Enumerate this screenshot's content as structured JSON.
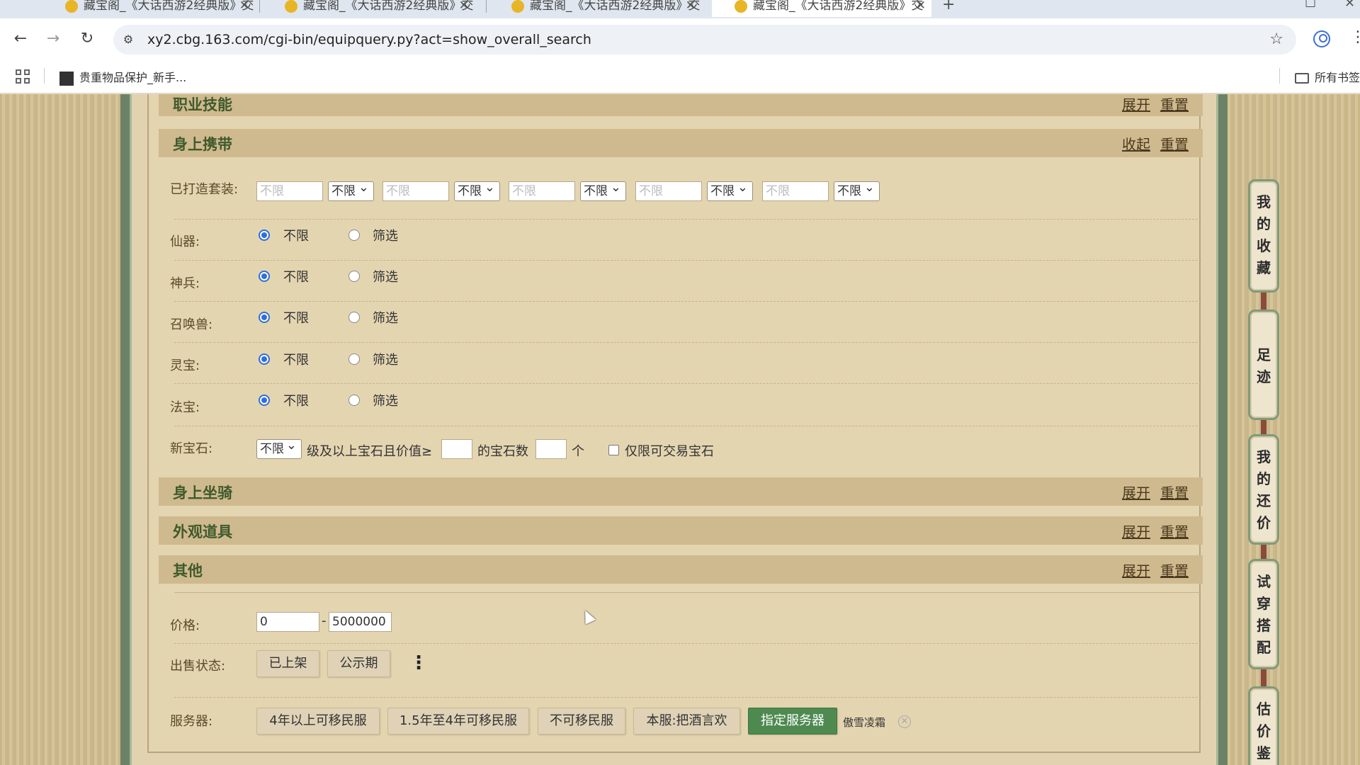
{
  "browser": {
    "tabs": [
      {
        "title": "藏宝阁_《大话西游2经典版》交"
      },
      {
        "title": "藏宝阁_《大话西游2经典版》交"
      },
      {
        "title": "藏宝阁_《大话西游2经典版》交"
      },
      {
        "title": "藏宝阁_《大话西游2经典版》交"
      }
    ],
    "new_tab": "+",
    "url": "xy2.cbg.163.com/cgi-bin/equipquery.py?act=show_overall_search",
    "bookmarks": [
      {
        "label": "贵重物品保护_新手..."
      }
    ],
    "all_bookmarks_label": "所有书签"
  },
  "sections": {
    "career_skill": {
      "title": "职业技能",
      "expand": "展开",
      "reset": "重置"
    },
    "carried": {
      "title": "身上携带",
      "collapse": "收起",
      "reset": "重置"
    },
    "mount": {
      "title": "身上坐骑",
      "expand": "展开",
      "reset": "重置"
    },
    "appearance": {
      "title": "外观道具",
      "expand": "展开",
      "reset": "重置"
    },
    "other": {
      "title": "其他",
      "expand": "展开",
      "reset": "重置"
    }
  },
  "carried": {
    "forged_set_label": "已打造套装:",
    "forged_set_inputs": [
      {
        "placeholder": "不限",
        "select": "不限"
      },
      {
        "placeholder": "不限",
        "select": "不限"
      },
      {
        "placeholder": "不限",
        "select": "不限"
      },
      {
        "placeholder": "不限",
        "select": "不限"
      },
      {
        "placeholder": "不限",
        "select": "不限"
      }
    ],
    "radio_rows": [
      {
        "label": "仙器:",
        "opt_any": "不限",
        "opt_filter": "筛选",
        "selected": "不限"
      },
      {
        "label": "神兵:",
        "opt_any": "不限",
        "opt_filter": "筛选",
        "selected": "不限"
      },
      {
        "label": "召唤兽:",
        "opt_any": "不限",
        "opt_filter": "筛选",
        "selected": "不限"
      },
      {
        "label": "灵宝:",
        "opt_any": "不限",
        "opt_filter": "筛选",
        "selected": "不限"
      },
      {
        "label": "法宝:",
        "opt_any": "不限",
        "opt_filter": "筛选",
        "selected": "不限"
      }
    ],
    "gem": {
      "label": "新宝石:",
      "level_select": "不限",
      "text_level": "级及以上宝石且价值≥",
      "value_input": "",
      "text_count": "的宝石数",
      "count_input": "",
      "text_unit": "个",
      "tradable_only_label": "仅限可交易宝石",
      "tradable_only_checked": false
    }
  },
  "other": {
    "price_label": "价格:",
    "price_min": "0",
    "price_sep": "-",
    "price_max": "5000000",
    "sale_status_label": "出售状态:",
    "sale_status_buttons": [
      "已上架",
      "公示期"
    ],
    "more_icon": "⋮",
    "server_label": "服务器:",
    "server_buttons": [
      "4年以上可移民服",
      "1.5年至4年可移民服",
      "不可移民服",
      "本服:把酒言欢",
      "指定服务器"
    ],
    "server_active": "指定服务器",
    "selected_server": "傲雪凌霜"
  },
  "side_tabs": [
    {
      "chars": [
        "我",
        "的",
        "收",
        "藏"
      ]
    },
    {
      "chars": [
        "足",
        "迹"
      ]
    },
    {
      "chars": [
        "我",
        "的",
        "还",
        "价"
      ]
    },
    {
      "chars": [
        "试",
        "穿",
        "搭",
        "配"
      ]
    },
    {
      "chars": [
        "估",
        "价",
        "鉴"
      ]
    }
  ],
  "colors": {
    "section_header_bg": "#cfb98e",
    "section_title": "#3f5a2c",
    "panel_bg": "#e4d5b1",
    "active_button": "#4e8a50",
    "radio_selected": "#2f6fdb"
  }
}
